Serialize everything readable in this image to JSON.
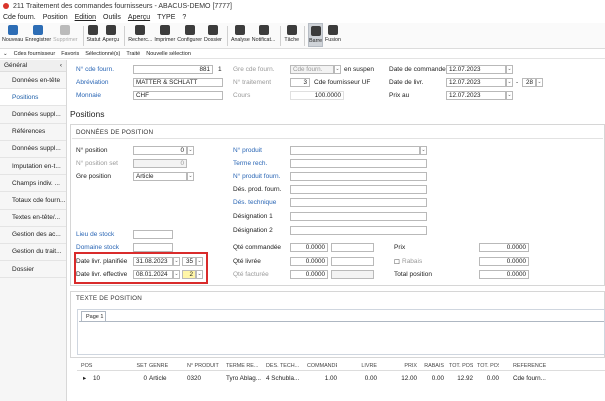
{
  "window": {
    "title": "211 Traitement des commandes fournisseurs - ABACUS-DEMO [7777]"
  },
  "menu": [
    "Cde fourn.",
    "Position",
    "Edition",
    "Outils",
    "Aperçu",
    "TYPE",
    "?"
  ],
  "toolbar": [
    {
      "label": "Nouveau",
      "icon": "new-icon",
      "color": "#2d6db5"
    },
    {
      "label": "Enregistrer",
      "icon": "save-icon",
      "color": "#2d6db5"
    },
    {
      "label": "Supprimer",
      "icon": "delete-icon",
      "color": "#bbbbbb",
      "disabled": true
    },
    {
      "label": "Statut",
      "icon": "status-icon",
      "color": "#3c3c3c"
    },
    {
      "label": "Aperçu",
      "icon": "preview-icon",
      "color": "#3c3c3c"
    },
    {
      "label": "Recherc...",
      "icon": "search-icon",
      "color": "#3c3c3c"
    },
    {
      "label": "Imprimer",
      "icon": "print-icon",
      "color": "#3c3c3c"
    },
    {
      "label": "Configurer",
      "icon": "configure-icon",
      "color": "#3c3c3c"
    },
    {
      "label": "Dossier",
      "icon": "folder-icon",
      "color": "#3c3c3c"
    },
    {
      "label": "Analyse",
      "icon": "analysis-icon",
      "color": "#3c3c3c"
    },
    {
      "label": "Notificat...",
      "icon": "notification-icon",
      "color": "#3c3c3c"
    },
    {
      "label": "Tâche",
      "icon": "task-icon",
      "color": "#3c3c3c"
    },
    {
      "label": "Barre",
      "icon": "bar-icon",
      "color": "#3c3c3c",
      "active": true
    },
    {
      "label": "Fusion",
      "icon": "merge-icon",
      "color": "#3c3c3c"
    }
  ],
  "subbar": [
    "Cdes fournisseur",
    "Favoris",
    "Sélectionné(s)",
    "Traité",
    "Nouvelle sélection"
  ],
  "sidebar": {
    "head": "Général",
    "items": [
      "Données en-tête",
      "Positions",
      "Données suppl...",
      "Références",
      "Données suppl...",
      "Imputation en-t...",
      "Champs indiv. ...",
      "Totaux cde fourn...",
      "Textes en-tête/...",
      "Gestion des ac...",
      "Gestion du trait...",
      "Dossier"
    ],
    "active_index": 1
  },
  "header": {
    "cde_fourn_label": "N° cde fourn.",
    "cde_fourn_value": "881",
    "cde_fourn_suffix": "1",
    "abreviation_label": "Abréviation",
    "abreviation_value": "MATTER & SCHLATT",
    "monnaie_label": "Monnaie",
    "monnaie_value": "CHF",
    "gre_cde_label": "Gre cde fourn.",
    "gre_cde_value": "Cde fourn.",
    "en_suspens": "en suspen",
    "traitement_label": "N° traitement",
    "traitement_value": "3",
    "traitement_text": "Cde fournisseur UF",
    "cours_label": "Cours",
    "cours_value": "100.0000",
    "date_commande_label": "Date de commande",
    "date_commande_value": "12.07.2023",
    "date_livr_label": "Date de livr.",
    "date_livr_value": "12.07.2023",
    "date_livr_week": "28",
    "prix_au_label": "Prix au",
    "prix_au_value": "12.07.2023"
  },
  "section_title": "Positions",
  "position": {
    "panel_title": "DONNÉES DE POSITION",
    "no_position_label": "N° position",
    "no_position_value": "0",
    "no_position_set_label": "N° position set",
    "no_position_set_value": "0",
    "gre_position_label": "Gre position",
    "gre_position_value": "Article",
    "produit_label": "N° produit",
    "terme_label": "Terme rech.",
    "produit_fourn_label": "N° produit fourn.",
    "des_prod_fourn_label": "Dés. prod. fourn.",
    "des_technique_label": "Dés. technique",
    "designation1_label": "Désignation 1",
    "designation2_label": "Désignation 2",
    "lieu_stock_label": "Lieu de stock",
    "domaine_stock_label": "Domaine stock",
    "date_planifiee_label": "Date livr. planifiée",
    "date_planifiee_value": "31.08.2023",
    "date_planifiee_week": "35",
    "date_effective_label": "Date livr. effective",
    "date_effective_value": "08.01.2024",
    "date_effective_week": "2",
    "qte_commandee_label": "Qté commandée",
    "qte_commandee_value": "0.0000",
    "qte_livree_label": "Qté livrée",
    "qte_livree_value": "0.0000",
    "qte_facturee_label": "Qté facturée",
    "qte_facturee_value": "0.0000",
    "prix_label": "Prix",
    "prix_value": "0.0000",
    "rabais_label": "Rabais",
    "rabais_value": "0.0000",
    "total_label": "Total position",
    "total_value": "0.0000"
  },
  "text_panel": {
    "title": "TEXTE DE POSITION",
    "tab": "Page 1"
  },
  "table": {
    "headers": [
      "POS",
      "SET",
      "GENRE",
      "N° PRODUIT",
      "TERME RE...",
      "DÉS. TECH...",
      "COMMANDÉ",
      "LIVRÉ",
      "PRIX",
      "RABAIS",
      "TOT. POS ...",
      "TOT. POS ...",
      "RÉFÉRENCE"
    ],
    "rows": [
      {
        "pos": "10",
        "set": "0",
        "genre": "Article",
        "produit": "0320",
        "terme": "Tyro Ablag...",
        "des": "4 Schubla...",
        "commande": "1.00",
        "livre": "0.00",
        "prix": "12.00",
        "rabais": "0.00",
        "tot1": "12.92",
        "tot2": "0.00",
        "ref": "Cde fourn..."
      }
    ]
  }
}
